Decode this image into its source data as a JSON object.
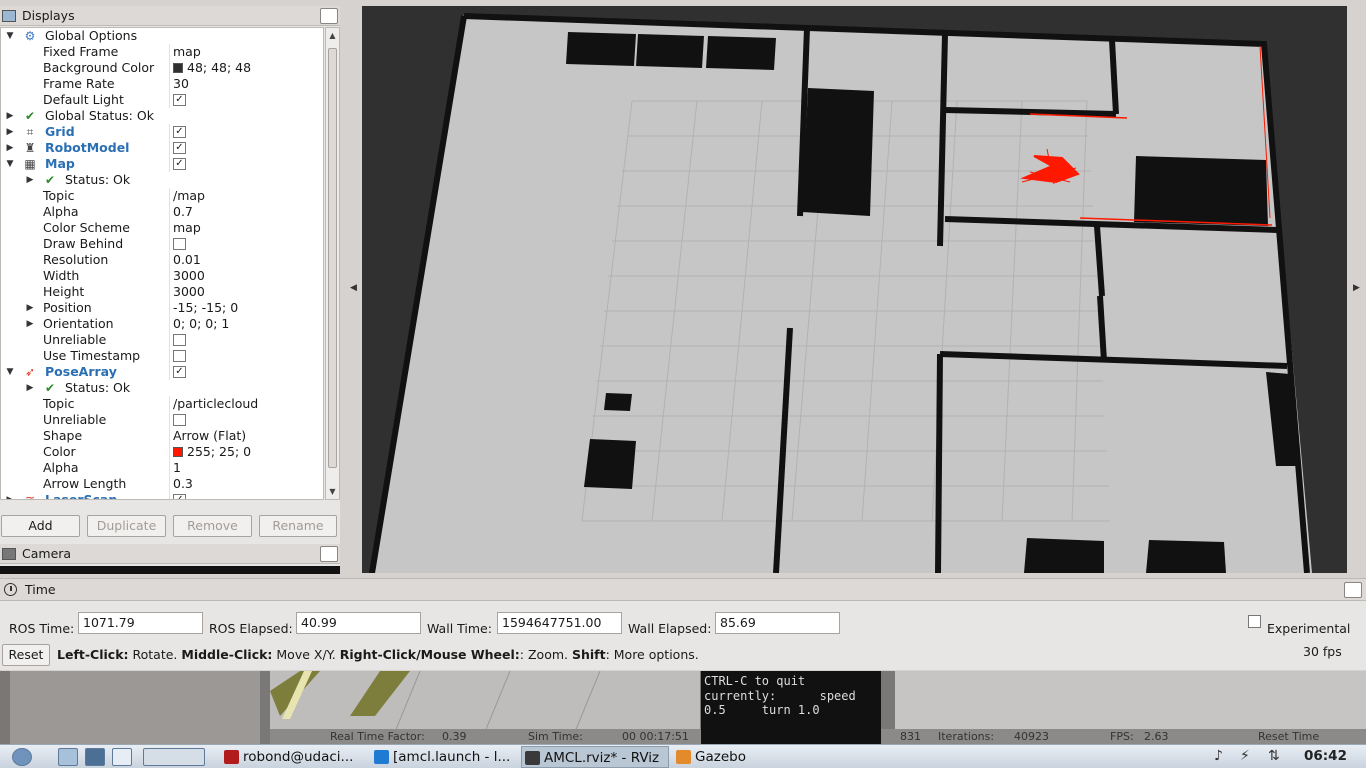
{
  "displays": {
    "title": "Displays",
    "tree": [
      {
        "indent": 0,
        "arrow": "down",
        "icon": "gear",
        "name": "Global Options",
        "plugin": false
      },
      {
        "indent": 1,
        "name": "Fixed Frame",
        "value": "map"
      },
      {
        "indent": 1,
        "name": "Background Color",
        "value": "48; 48; 48",
        "swatch": "#303030"
      },
      {
        "indent": 1,
        "name": "Frame Rate",
        "value": "30"
      },
      {
        "indent": 1,
        "name": "Default Light",
        "check": true
      },
      {
        "indent": 0,
        "arrow": "right",
        "icon": "check",
        "name": "Global Status: Ok"
      },
      {
        "indent": 0,
        "arrow": "right",
        "icon": "grid",
        "name": "Grid",
        "plugin": true,
        "check": true
      },
      {
        "indent": 0,
        "arrow": "right",
        "icon": "robot",
        "name": "RobotModel",
        "plugin": true,
        "check": true
      },
      {
        "indent": 0,
        "arrow": "down",
        "icon": "map",
        "name": "Map",
        "plugin": true,
        "check": true
      },
      {
        "indent": 1,
        "arrow": "right",
        "icon": "check",
        "name": "Status: Ok"
      },
      {
        "indent": 1,
        "name": "Topic",
        "value": "/map"
      },
      {
        "indent": 1,
        "name": "Alpha",
        "value": "0.7"
      },
      {
        "indent": 1,
        "name": "Color Scheme",
        "value": "map"
      },
      {
        "indent": 1,
        "name": "Draw Behind",
        "check": false
      },
      {
        "indent": 1,
        "name": "Resolution",
        "value": "0.01"
      },
      {
        "indent": 1,
        "name": "Width",
        "value": "3000"
      },
      {
        "indent": 1,
        "name": "Height",
        "value": "3000"
      },
      {
        "indent": 1,
        "arrow": "right",
        "name": "Position",
        "value": "-15; -15; 0"
      },
      {
        "indent": 1,
        "arrow": "right",
        "name": "Orientation",
        "value": "0; 0; 0; 1"
      },
      {
        "indent": 1,
        "name": "Unreliable",
        "check": false
      },
      {
        "indent": 1,
        "name": "Use Timestamp",
        "check": false
      },
      {
        "indent": 0,
        "arrow": "down",
        "icon": "posearray",
        "name": "PoseArray",
        "plugin": true,
        "check": true
      },
      {
        "indent": 1,
        "arrow": "right",
        "icon": "check",
        "name": "Status: Ok"
      },
      {
        "indent": 1,
        "name": "Topic",
        "value": "/particlecloud"
      },
      {
        "indent": 1,
        "name": "Unreliable",
        "check": false
      },
      {
        "indent": 1,
        "name": "Shape",
        "value": "Arrow (Flat)"
      },
      {
        "indent": 1,
        "name": "Color",
        "value": "255; 25; 0",
        "swatch": "#ff1900"
      },
      {
        "indent": 1,
        "name": "Alpha",
        "value": "1"
      },
      {
        "indent": 1,
        "name": "Arrow Length",
        "value": "0.3"
      },
      {
        "indent": 0,
        "arrow": "right",
        "icon": "laser",
        "name": "LaserScan",
        "plugin": true,
        "check": true
      }
    ],
    "buttons": {
      "add": "Add",
      "duplicate": "Duplicate",
      "remove": "Remove",
      "rename": "Rename"
    }
  },
  "camera": {
    "title": "Camera"
  },
  "time": {
    "title": "Time",
    "ros_time_label": "ROS Time:",
    "ros_time": "1071.79",
    "ros_elapsed_label": "ROS Elapsed:",
    "ros_elapsed": "40.99",
    "wall_time_label": "Wall Time:",
    "wall_time": "1594647751.00",
    "wall_elapsed_label": "Wall Elapsed:",
    "wall_elapsed": "85.69",
    "experimental": "Experimental",
    "reset": "Reset",
    "hint": {
      "k1": "Left-Click:",
      "v1": " Rotate. ",
      "k2": "Middle-Click:",
      "v2": " Move X/Y. ",
      "k3": "Right-Click/Mouse Wheel:",
      "v3": ": Zoom. ",
      "k4": "Shift",
      "v4": ": More options."
    },
    "fps": "30 fps"
  },
  "terminal": {
    "l1": "CTRL-C to quit",
    "l2": "",
    "l3": "currently:      speed",
    "l4": "0.5     turn 1.0"
  },
  "gazebo_status": {
    "rtf_label": "Real Time Factor:",
    "rtf": "0.39",
    "sim_label": "Sim Time:",
    "sim": "00 00:17:51",
    "iter_prefix": "831",
    "iter_label": "Iterations:",
    "iter": "40923",
    "fps_label": "FPS:",
    "fps": "2.63",
    "reset_time": "Reset Time"
  },
  "taskbar": {
    "tasks": [
      "robond@udaci...",
      "[amcl.launch - l...",
      "AMCL.rviz* - RViz",
      "Gazebo"
    ],
    "clock": "06:42"
  },
  "colors": {
    "particles": "#ff1900",
    "map_free": "#c6c6c6",
    "map_wall": "#111111",
    "background": "#303030"
  }
}
